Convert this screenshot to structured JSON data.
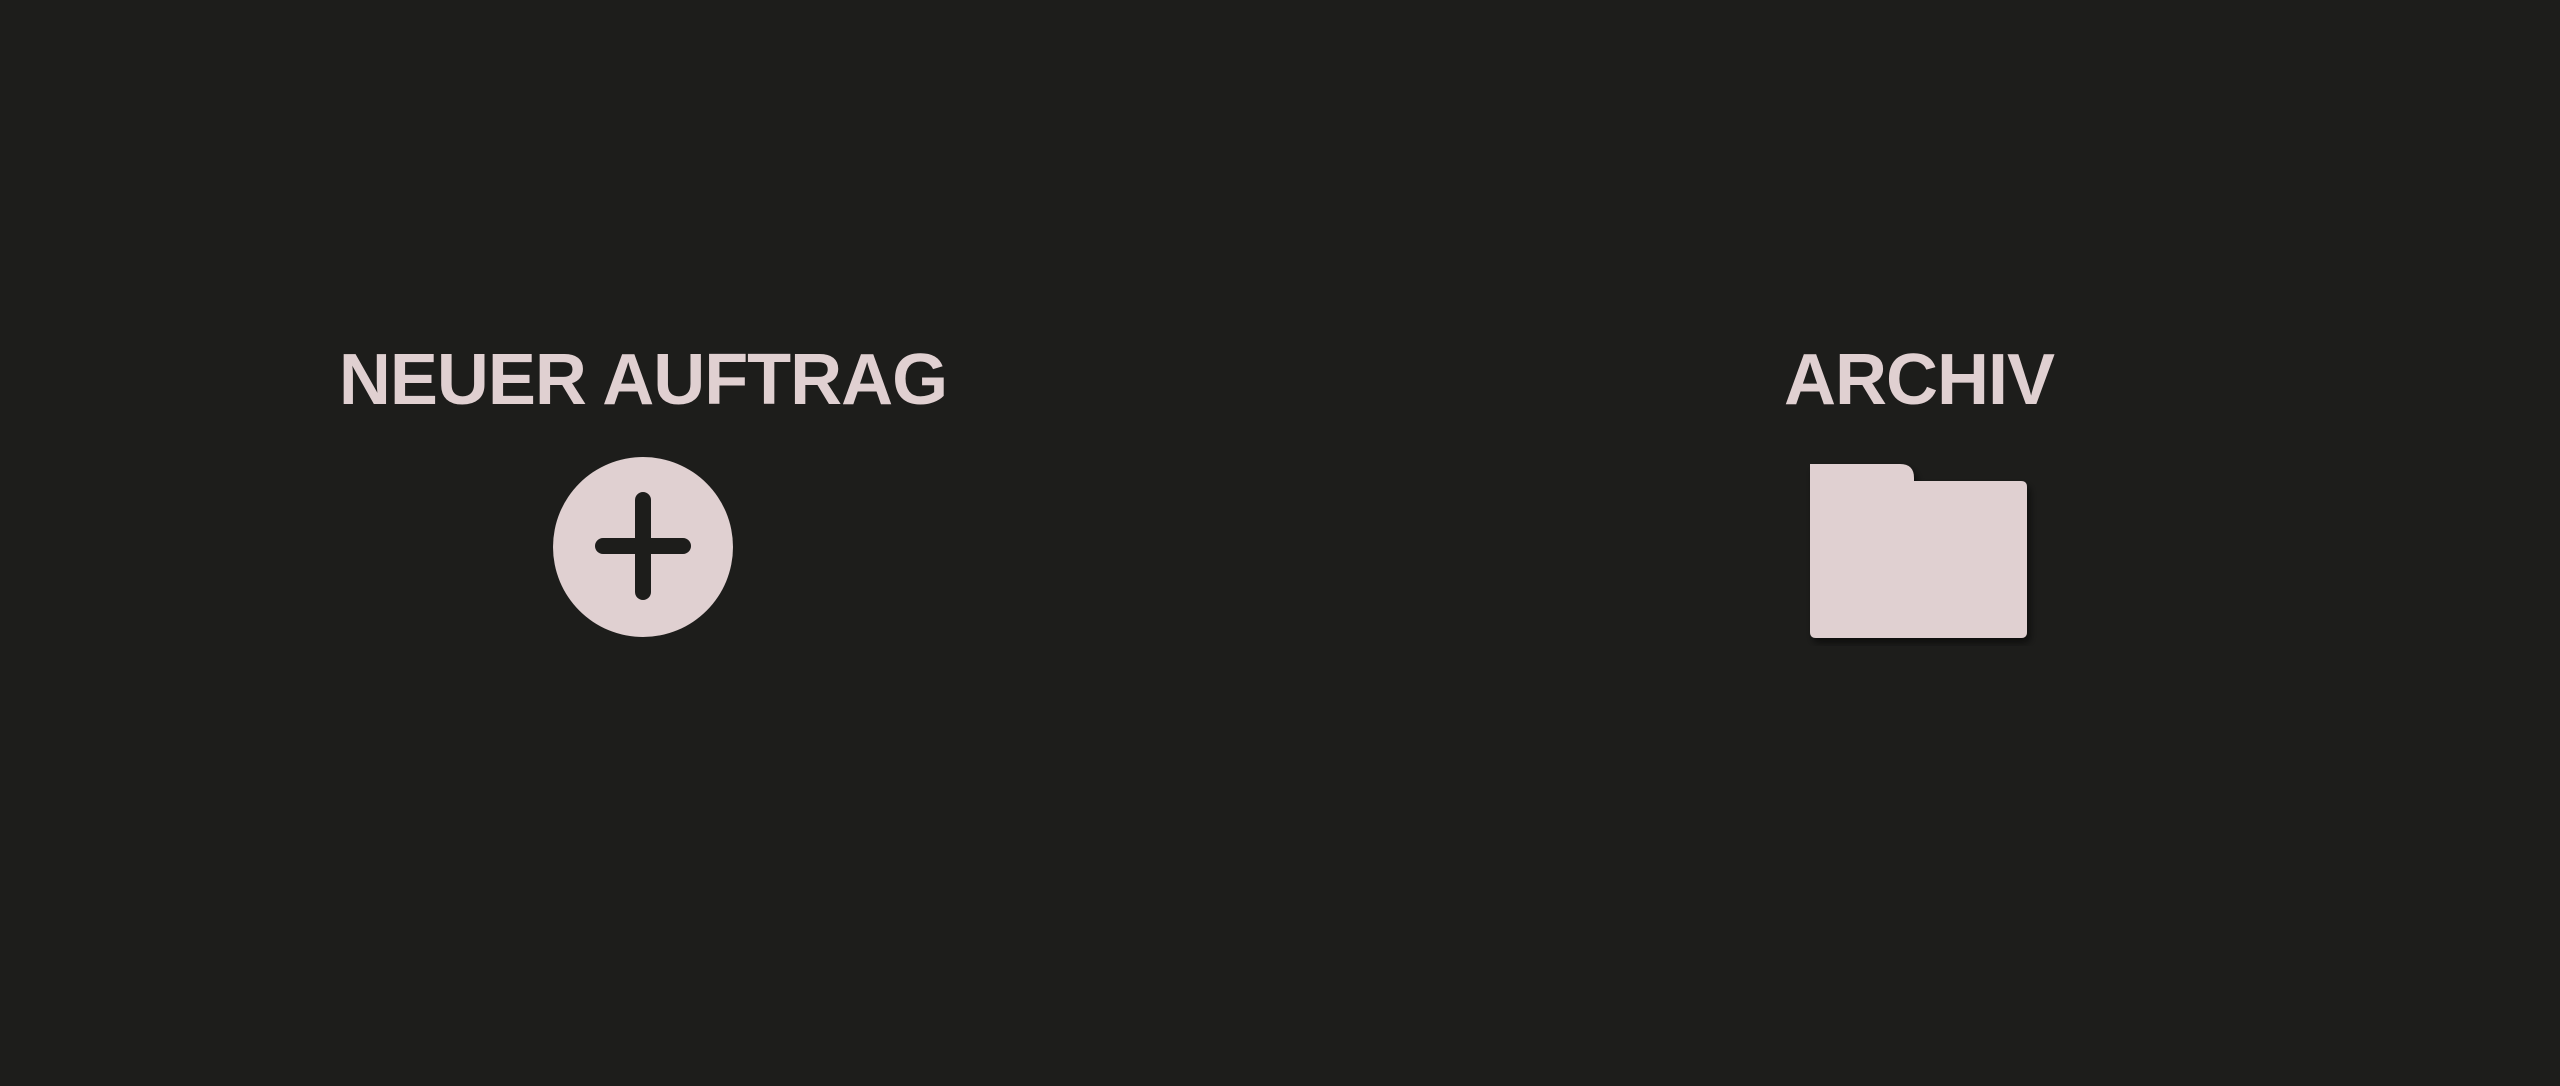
{
  "colors": {
    "background": "#1d1d1b",
    "foreground": "#e0d0d1"
  },
  "tiles": [
    {
      "label": "NEUER AUFTRAG",
      "icon": "add-circle-icon"
    },
    {
      "label": "ARCHIV",
      "icon": "folder-icon"
    }
  ]
}
